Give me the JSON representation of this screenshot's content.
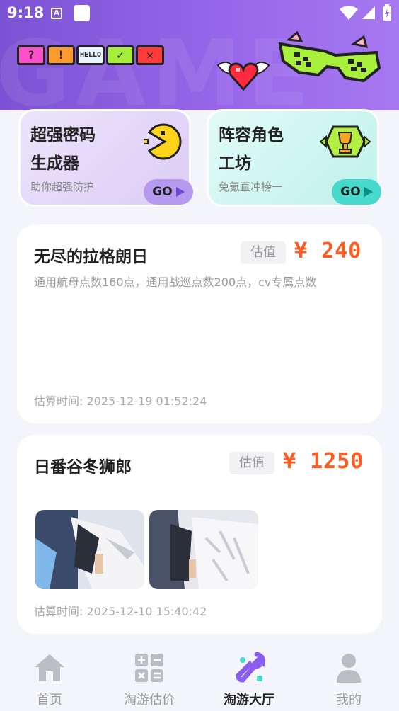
{
  "status_bar": {
    "time": "9:18",
    "notif_letter": "A"
  },
  "header": {
    "background_word": "GAME",
    "pixel_buttons": [
      {
        "text": "?",
        "color": "#ff4fc9",
        "icon": "question-icon"
      },
      {
        "text": "!",
        "color": "#ff9a2e",
        "icon": "exclamation-icon"
      },
      {
        "text": "HELLO",
        "color": "#e9f4ff",
        "icon": "hello-icon"
      },
      {
        "text": "✓",
        "color": "#a6ee3a",
        "icon": "check-icon"
      },
      {
        "text": "✕",
        "color": "#ff3b3b",
        "icon": "cross-icon"
      }
    ]
  },
  "features": [
    {
      "title_line1": "超强密码",
      "title_line2": "生成器",
      "subtitle": "助你超强防护",
      "button": "GO",
      "icon": "pacman-icon",
      "accent": "#b69af0"
    },
    {
      "title_line1": "阵容角色",
      "title_line2": "工坊",
      "subtitle": "免氪直冲榜一",
      "button": "GO",
      "icon": "trophy-icon",
      "accent": "#47d9cb"
    }
  ],
  "items": [
    {
      "title": "无尽的拉格朗日",
      "tag": "估值",
      "price": "¥ 240",
      "description": "通用航母点数160点，通用战巡点数200点，cv专属点数",
      "time_label": "估算时间: 2025-12-19 01:52:24"
    },
    {
      "title": "日番谷冬狮郎",
      "tag": "估值",
      "price": "¥ 1250",
      "time_label": "估算时间: 2025-12-10 15:40:42"
    }
  ],
  "nav": [
    {
      "label": "首页",
      "icon": "home-icon",
      "active": false
    },
    {
      "label": "淘游估价",
      "icon": "calculator-icon",
      "active": false
    },
    {
      "label": "淘游大厅",
      "icon": "wrench-icon",
      "active": true
    },
    {
      "label": "我的",
      "icon": "person-icon",
      "active": false
    }
  ],
  "colors": {
    "header": "#8a5be0",
    "price": "#ff5a1f",
    "nav_active": "#8b5cf0"
  }
}
